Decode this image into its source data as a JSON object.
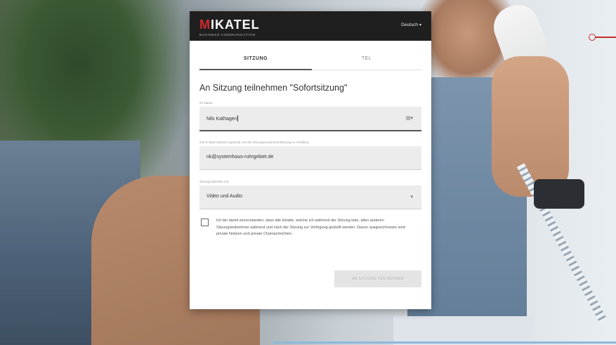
{
  "header": {
    "brand_prefix": "M",
    "brand_rest": "IKATEL",
    "tagline": "BUSINESS KOMMUNIKATION",
    "language": "Deutsch",
    "language_caret": "▾"
  },
  "tabs": [
    {
      "label": "SITZUNG",
      "active": true
    },
    {
      "label": "TEL",
      "active": false
    }
  ],
  "title": "An Sitzung teilnehmen \"Sofortsitzung\"",
  "fields": {
    "name": {
      "label": "Ihr Name",
      "value": "Nils Kathagen",
      "icon": "contact-card-icon",
      "icon_glyph": "▤▾"
    },
    "email": {
      "label": "Ihre E-Mail-Adresse (optional, um die Sitzungszusammenfassung zu erhalten)",
      "value": "nk@systemhaus-ruhrgebiet.de"
    },
    "media": {
      "label": "Sitzung beitreten mit",
      "value": "Video und Audio",
      "caret": "▾"
    }
  },
  "consent_text": "Ich bin damit einverstanden, dass alle Inhalte, welche ich während der Sitzung teile, allen anderen Sitzungsteilnehmer während und nach der Sitzung zur Verfügung gestellt werden. Davon ausgeschlossen sind private Notizen und private Chatnachrichten.",
  "consent_checked": false,
  "join_button": "AN SITZUNG TEILNEHMEN",
  "colors": {
    "brand_red": "#d22b2b",
    "topbar": "#1f1f20",
    "accent_dark": "#555555"
  }
}
